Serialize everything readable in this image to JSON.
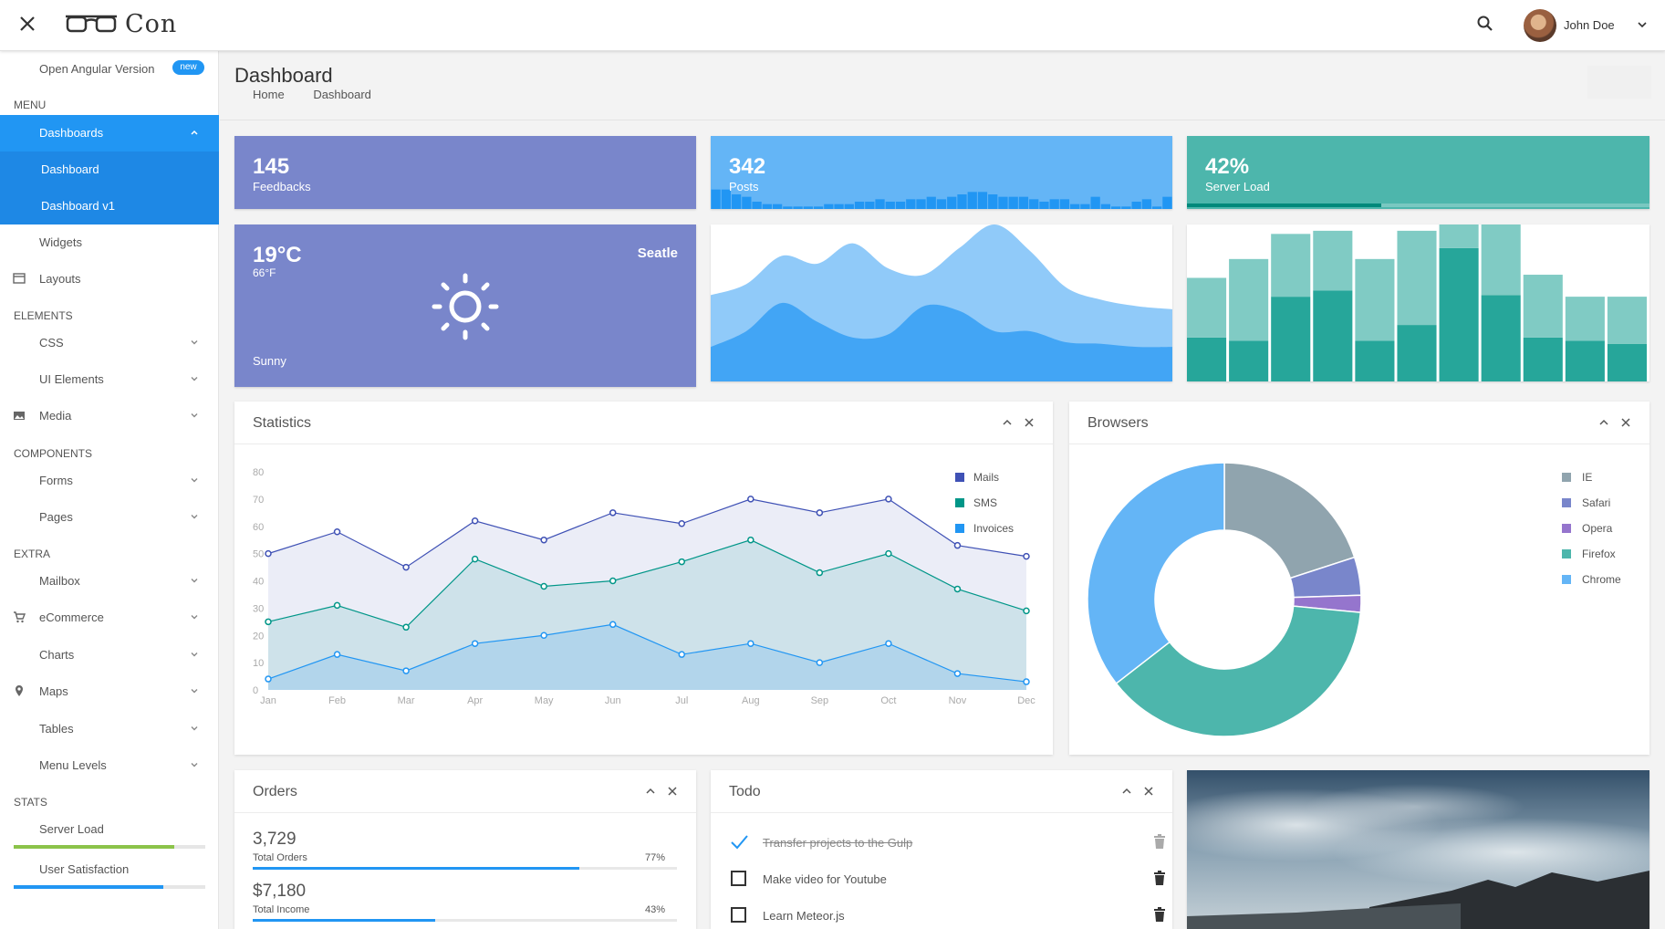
{
  "header": {
    "logo": "Con",
    "user_name": "John Doe"
  },
  "sidebar": {
    "angular_link": "Open Angular Version",
    "angular_badge": "new",
    "menu_heading": "MENU",
    "dashboards": "Dashboards",
    "dashboard": "Dashboard",
    "dashboard_v1": "Dashboard v1",
    "widgets": "Widgets",
    "layouts": "Layouts",
    "elements_heading": "ELEMENTS",
    "css": "CSS",
    "ui_elements": "UI Elements",
    "media": "Media",
    "components_heading": "COMPONENTS",
    "forms": "Forms",
    "pages": "Pages",
    "extra_heading": "EXTRA",
    "mailbox": "Mailbox",
    "ecommerce": "eCommerce",
    "charts": "Charts",
    "maps": "Maps",
    "tables": "Tables",
    "menu_levels": "Menu Levels",
    "stats_heading": "STATS",
    "server_load": "Server Load",
    "server_load_level": 0.84,
    "user_satisfaction": "User Satisfaction",
    "user_satisfaction_level": 0.78
  },
  "page": {
    "title": "Dashboard",
    "crumb_home": "Home",
    "crumb_current": "Dashboard"
  },
  "tiles": {
    "feedbacks_value": "145",
    "feedbacks_label": "Feedbacks",
    "posts_value": "342",
    "posts_label": "Posts",
    "load_value": "42%",
    "load_label": "Server Load",
    "load_level": 0.42,
    "weather_temp": "19°C",
    "weather_temp_f": "66°F",
    "weather_city": "Seatle",
    "weather_cond": "Sunny"
  },
  "colors": {
    "primary": "#2196f3",
    "indigo_tile": "#7986cb",
    "blue_tile": "#64b5f6",
    "teal_tile": "#4db6ac",
    "mails": "#3f51b5",
    "sms": "#009688",
    "invoices": "#2196f3"
  },
  "statistics": {
    "title": "Statistics"
  },
  "browsers": {
    "title": "Browsers"
  },
  "orders": {
    "title": "Orders",
    "total_orders_value": "3,729",
    "total_orders_label": "Total Orders",
    "total_orders_pct": "77%",
    "total_orders_level": 0.77,
    "total_income_value": "$7,180",
    "total_income_label": "Total Income",
    "total_income_pct": "43%",
    "total_income_level": 0.43
  },
  "todo": {
    "title": "Todo",
    "items": [
      "Transfer projects to the Gulp",
      "Make video for Youtube",
      "Learn Meteor.js"
    ],
    "done": [
      true,
      false,
      false
    ]
  },
  "chart_data": [
    {
      "type": "bar",
      "values": [
        8,
        8,
        6,
        5,
        3,
        2,
        2,
        1,
        1,
        1,
        1,
        2,
        2,
        2,
        3,
        3,
        4,
        3,
        3,
        4,
        4,
        5,
        4,
        5,
        6,
        7,
        7,
        6,
        5,
        5,
        5,
        4,
        3,
        4,
        4,
        2,
        2,
        5,
        2,
        1,
        1,
        3,
        4,
        1,
        5
      ],
      "ylim": [
        0,
        9
      ]
    },
    {
      "type": "area",
      "series": [
        {
          "values": [
            55,
            62,
            80,
            75,
            88,
            72,
            68,
            85,
            100,
            83,
            60,
            52,
            48,
            46
          ]
        },
        {
          "values": [
            22,
            32,
            50,
            38,
            28,
            30,
            48,
            45,
            32,
            32,
            25,
            24,
            22,
            22
          ]
        }
      ],
      "ylim": [
        0,
        100
      ]
    },
    {
      "type": "bar",
      "stacked": true,
      "series": [
        {
          "values": [
            28,
            26,
            54,
            58,
            26,
            36,
            85,
            55,
            28,
            26,
            24
          ]
        },
        {
          "values": [
            38,
            52,
            40,
            38,
            52,
            60,
            50,
            52,
            40,
            28,
            30
          ]
        }
      ],
      "ylim": [
        0,
        100
      ]
    },
    {
      "type": "line",
      "categories": [
        "Jan",
        "Feb",
        "Mar",
        "Apr",
        "May",
        "Jun",
        "Jul",
        "Aug",
        "Sep",
        "Oct",
        "Nov",
        "Dec"
      ],
      "series": [
        {
          "name": "Mails",
          "values": [
            50,
            58,
            45,
            62,
            55,
            65,
            61,
            70,
            65,
            70,
            53,
            49
          ]
        },
        {
          "name": "SMS",
          "values": [
            25,
            31,
            23,
            48,
            38,
            40,
            47,
            55,
            43,
            50,
            37,
            29
          ]
        },
        {
          "name": "Invoices",
          "values": [
            4,
            13,
            7,
            17,
            20,
            24,
            13,
            17,
            10,
            17,
            6,
            3
          ]
        }
      ],
      "yticks": [
        0,
        10,
        20,
        30,
        40,
        50,
        60,
        70,
        80
      ],
      "ylim": [
        0,
        80
      ],
      "legend": "top-right"
    },
    {
      "type": "pie",
      "categories": [
        "IE",
        "Safari",
        "Opera",
        "Firefox",
        "Chrome"
      ],
      "values": [
        20,
        4.5,
        2,
        38,
        35.5
      ],
      "colors": [
        "#90a4ae",
        "#7986cb",
        "#9575cd",
        "#4db6ac",
        "#64b5f6"
      ],
      "legend": "right"
    }
  ]
}
